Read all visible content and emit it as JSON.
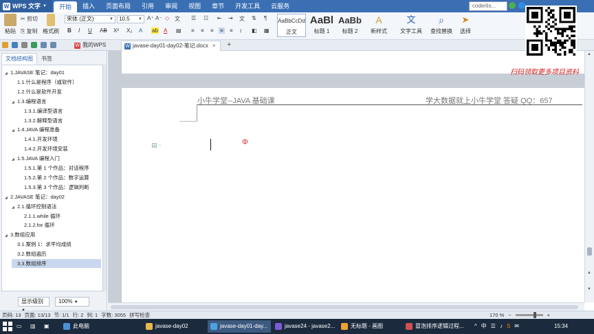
{
  "app": {
    "name": "WPS 文字"
  },
  "menu": {
    "tabs": [
      "开始",
      "插入",
      "页面布局",
      "引用",
      "审阅",
      "视图",
      "章节",
      "开发工具",
      "云服务"
    ],
    "active": "开始"
  },
  "browser_tab": {
    "label": "coderlis..."
  },
  "ribbon": {
    "paste": "粘贴",
    "cut": "剪切",
    "copy": "复制",
    "format_painter": "格式刷",
    "font_name": "宋体 (正文)",
    "font_size": "10.5",
    "styles": [
      {
        "preview": "AaBbCcDd",
        "name": "正文"
      },
      {
        "preview": "AaBl",
        "name": "标题 1"
      },
      {
        "preview": "AaBb",
        "name": "标题 2"
      }
    ],
    "new_style": "新样式",
    "text_tools": "文字工具",
    "find_replace": "查找替换",
    "select": "选择"
  },
  "doc_tabs": [
    {
      "label": "我的WPS",
      "active": false
    },
    {
      "label": "javase-day01-day02-笔记.docx",
      "active": true
    }
  ],
  "nav": {
    "tabs": [
      "文档结构图",
      "书签"
    ],
    "items": [
      {
        "label": "1.JAVASE 笔记：day01",
        "level": 0,
        "expand": true
      },
      {
        "label": "1.1.什么是程序（或软件）",
        "level": 1,
        "expand": false
      },
      {
        "label": "1.2.什么是软件开发",
        "level": 1,
        "expand": false
      },
      {
        "label": "1.3.编程语言",
        "level": 1,
        "expand": true
      },
      {
        "label": "1.3.1.编译型语言",
        "level": 2,
        "expand": false
      },
      {
        "label": "1.3.2.解释型语言",
        "level": 2,
        "expand": false
      },
      {
        "label": "1.4.JAVA 编程准备",
        "level": 1,
        "expand": true
      },
      {
        "label": "1.4.1.开发环境",
        "level": 2,
        "expand": false
      },
      {
        "label": "1.4.2.开发环境安装",
        "level": 2,
        "expand": false
      },
      {
        "label": "1.5.JAVA 编程入门",
        "level": 1,
        "expand": true
      },
      {
        "label": "1.5.1.第 1 个作品：对话程序",
        "level": 2,
        "expand": false
      },
      {
        "label": "1.5.2.第 2 个作品：数字运算",
        "level": 2,
        "expand": false
      },
      {
        "label": "1.5.3.第 3 个作品：逻辑判断",
        "level": 2,
        "expand": false
      },
      {
        "label": "2.JAVASE 笔记：day02",
        "level": 0,
        "expand": true
      },
      {
        "label": "2.1.循环控制语法",
        "level": 1,
        "expand": true
      },
      {
        "label": "2.1.1.while 循环",
        "level": 2,
        "expand": false
      },
      {
        "label": "2.1.2.for 循环",
        "level": 2,
        "expand": false
      },
      {
        "label": "3.数组应用",
        "level": 0,
        "expand": true
      },
      {
        "label": "3.1.案例 1：求平均成绩",
        "level": 1,
        "expand": false
      },
      {
        "label": "3.2.数组遍历",
        "level": 1,
        "expand": false
      },
      {
        "label": "3.3.数组排序",
        "level": 1,
        "expand": false,
        "selected": true
      }
    ],
    "display_level": "显示级别",
    "zoom": "100%"
  },
  "document": {
    "header_left": "小牛学堂--JAVA 基础课",
    "header_right": "学大数据就上小牛学堂  答疑 QQ：657",
    "promo": "扫码领取更多项目资料"
  },
  "status": {
    "items": [
      "页码: 13",
      "页面: 13/13",
      "节: 1/1",
      "行: 2",
      "列: 1",
      "字数: 3055",
      "拼写检查"
    ],
    "zoom": "170 %"
  },
  "taskbar": {
    "apps": [
      {
        "label": "此电脑",
        "color": "#4a90d9"
      },
      {
        "label": "javase-day02",
        "color": "#e8b84a"
      },
      {
        "label": "javase-day01-day...",
        "color": "#4aa3df",
        "active": true
      },
      {
        "label": "javase24 - javase2...",
        "color": "#7a5bd6"
      },
      {
        "label": "无标题 - 画图",
        "color": "#f0a030"
      },
      {
        "label": "冒泡排序逻辑过程...",
        "color": "#d05050"
      }
    ],
    "time": "15:34",
    "ime": "中"
  }
}
